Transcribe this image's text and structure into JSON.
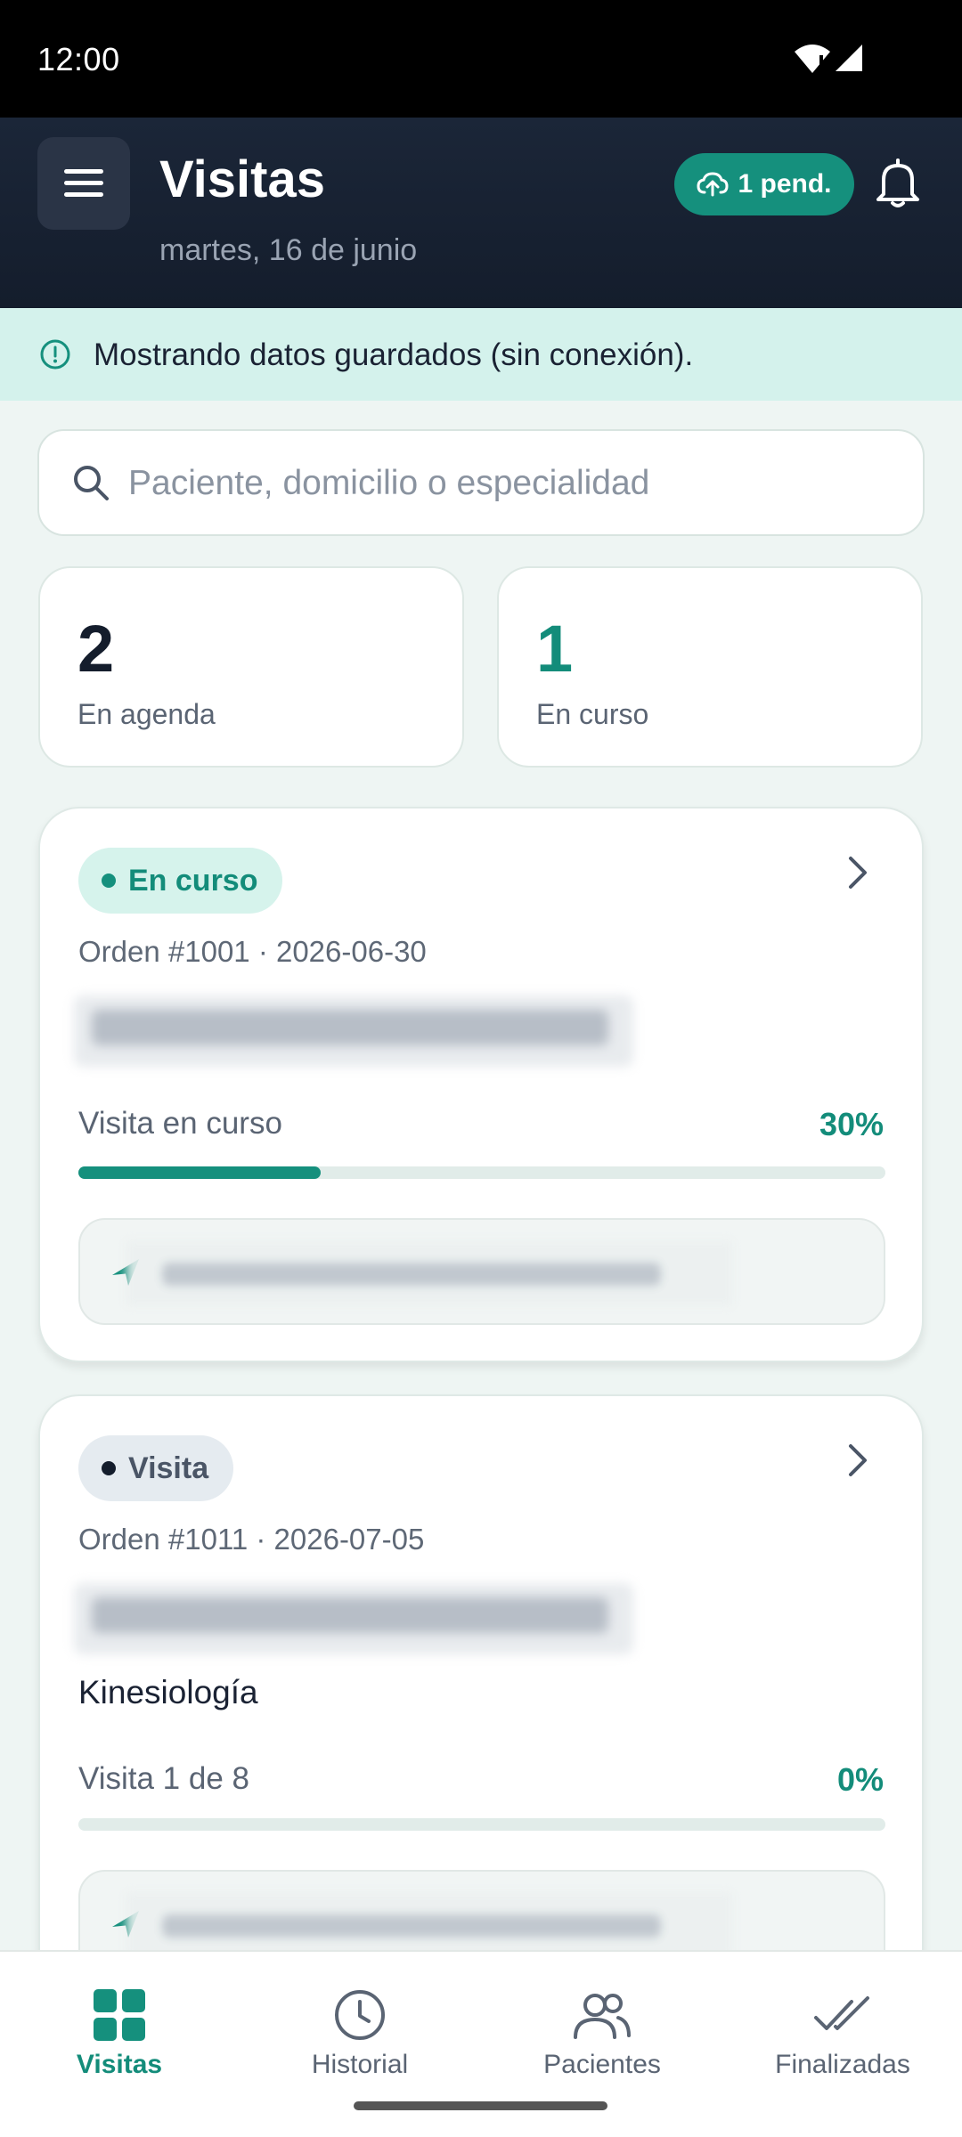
{
  "status_bar": {
    "time": "12:00"
  },
  "header": {
    "title": "Visitas",
    "date": "martes, 16 de junio",
    "pending_badge": "1 pend."
  },
  "banner": {
    "text": "Mostrando datos guardados (sin conexión)."
  },
  "search": {
    "placeholder": "Paciente, domicilio o especialidad",
    "value": ""
  },
  "stats": [
    {
      "value": "2",
      "label": "En agenda"
    },
    {
      "value": "1",
      "label": "En curso"
    }
  ],
  "visits": [
    {
      "status": "En curso",
      "order": "Orden #1001 · 2026-06-30",
      "patient": "",
      "specialty": "",
      "progress_label": "Visita en curso",
      "progress_text": "30%",
      "progress": 0.3,
      "address": ""
    },
    {
      "status": "Visita",
      "order": "Orden #1011 · 2026-07-05",
      "patient": "",
      "specialty": "Kinesiología",
      "progress_label": "Visita 1 de 8",
      "progress_text": "0%",
      "progress": 0.0,
      "address": ""
    }
  ],
  "bottom_nav": [
    {
      "label": "Visitas",
      "icon": "grid-icon",
      "active": true
    },
    {
      "label": "Historial",
      "icon": "clock-icon",
      "active": false
    },
    {
      "label": "Pacientes",
      "icon": "users-icon",
      "active": false
    },
    {
      "label": "Finalizadas",
      "icon": "double-check-icon",
      "active": false
    }
  ],
  "colors": {
    "accent": "#15907d",
    "header_bg": "#141d2c",
    "banner_bg": "#d4f2ec"
  }
}
